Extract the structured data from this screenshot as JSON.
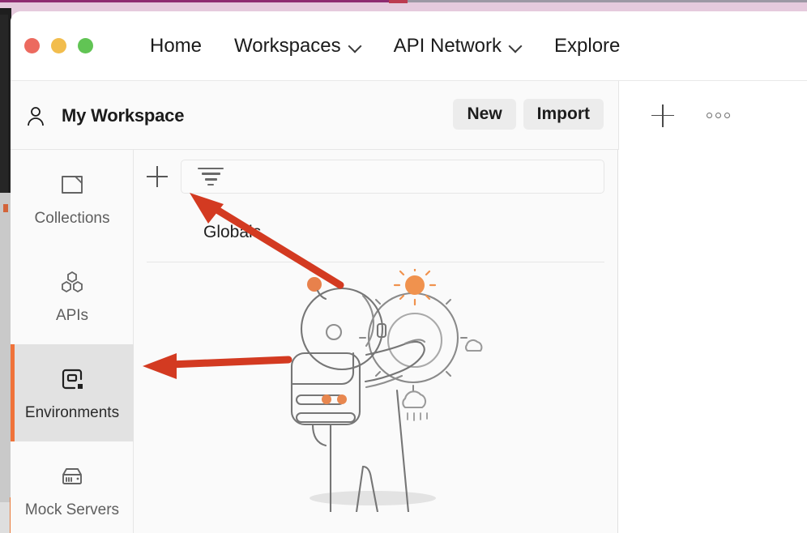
{
  "window": {
    "traffic_lights": [
      {
        "name": "close",
        "color": "#ec6a5f"
      },
      {
        "name": "minimize",
        "color": "#f2bd4d"
      },
      {
        "name": "maximize",
        "color": "#61c454"
      }
    ]
  },
  "topnav": {
    "items": [
      {
        "label": "Home",
        "has_chevron": false
      },
      {
        "label": "Workspaces",
        "has_chevron": true
      },
      {
        "label": "API Network",
        "has_chevron": true
      },
      {
        "label": "Explore",
        "has_chevron": false
      }
    ]
  },
  "workspace_bar": {
    "icon": "user-icon",
    "title": "My Workspace",
    "new_label": "New",
    "import_label": "Import",
    "add_icon": "plus-icon",
    "more_icon": "ellipsis-icon"
  },
  "sidebar": {
    "items": [
      {
        "label": "Collections",
        "icon": "collections-icon",
        "active": false
      },
      {
        "label": "APIs",
        "icon": "apis-icon",
        "active": false
      },
      {
        "label": "Environments",
        "icon": "environments-icon",
        "active": true
      },
      {
        "label": "Mock Servers",
        "icon": "mock-servers-icon",
        "active": false
      }
    ],
    "active_accent": "#f0733a"
  },
  "list_panel": {
    "add_icon": "plus-icon",
    "filter_icon": "filter-icon",
    "filter_placeholder": "",
    "filter_value": "",
    "entries": [
      {
        "label": "Globals"
      }
    ],
    "empty_illustration": "astronaut-illustration"
  },
  "annotations": {
    "color": "#d33a21",
    "arrows": [
      {
        "name": "arrow-to-add-environment",
        "points_to": "add-environment-button"
      },
      {
        "name": "arrow-to-environments-tab",
        "points_to": "sidebar-item-environments"
      }
    ]
  },
  "colors": {
    "accent_orange": "#f0733a",
    "annotation_red": "#d33a21",
    "panel_bg": "#fafafa",
    "desktop_pink": "#e5cadd"
  }
}
